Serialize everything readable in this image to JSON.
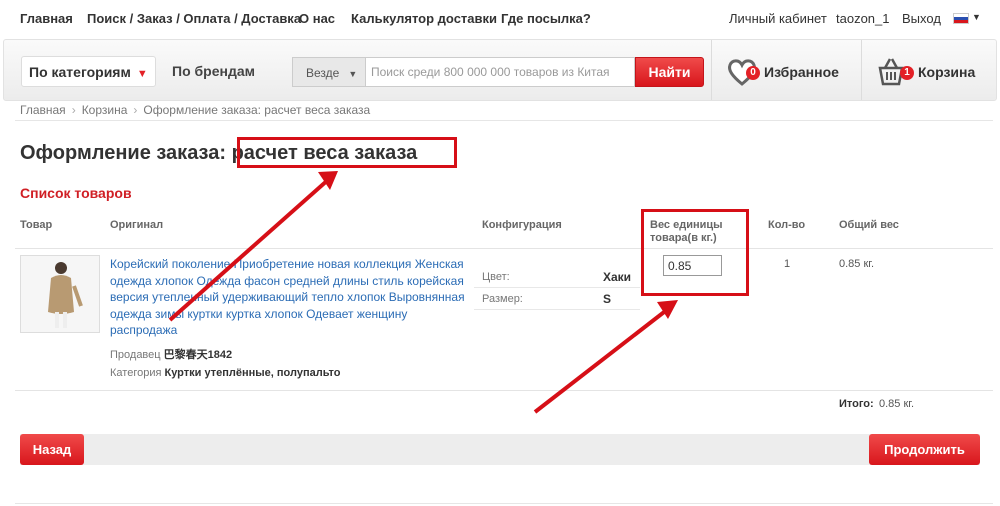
{
  "topnav": {
    "links": [
      "Главная",
      "Поиск / Заказ / Оплата / Доставка",
      "О нас",
      "Калькулятор доставки",
      "Где посылка?"
    ],
    "account": "Личный кабинет",
    "username": "taozon_1",
    "logout": "Выход"
  },
  "header": {
    "category_select": "По категориям",
    "brands": "По брендам",
    "search_scope": "Везде",
    "search_placeholder": "Поиск среди 800 000 000 товаров из Китая",
    "search_button": "Найти",
    "favorites_label": "Избранное",
    "favorites_count": "0",
    "cart_label": "Корзина",
    "cart_count": "1"
  },
  "breadcrumb": [
    "Главная",
    "Корзина",
    "Оформление заказа: расчет веса заказа"
  ],
  "page": {
    "title": "Оформление заказа: расчет веса заказа",
    "section": "Список товаров"
  },
  "table": {
    "headers": [
      "Товар",
      "Оригинал",
      "Конфигурация",
      "Вес единицы товара(в кг.)",
      "Кол-во",
      "Общий вес"
    ],
    "rows": [
      {
        "title": "Корейский поколение Приобретение новая коллекция Женская одежда хлопок Одежда фасон средней длины стиль корейская версия утепленный удерживающий тепло хлопок Выровнянная одежда зимы куртки куртка хлопок Одевает женщину распродажа",
        "seller_label": "Продавец",
        "seller": "巴黎春天1842",
        "category_label": "Категория",
        "category": "Куртки утеплённые, полупальто",
        "config": [
          {
            "key": "Цвет:",
            "value": "Хаки"
          },
          {
            "key": "Размер:",
            "value": "S"
          }
        ],
        "unit_weight": "0.85",
        "qty": "1",
        "total_weight": "0.85 кг."
      }
    ],
    "total_label": "Итого:",
    "total_value": "0.85 кг."
  },
  "buttons": {
    "back": "Назад",
    "continue": "Продолжить"
  },
  "colors": {
    "accent_red": "#d8161c",
    "link_blue": "#2b6cb5",
    "highlight_red": "#d60f17"
  }
}
